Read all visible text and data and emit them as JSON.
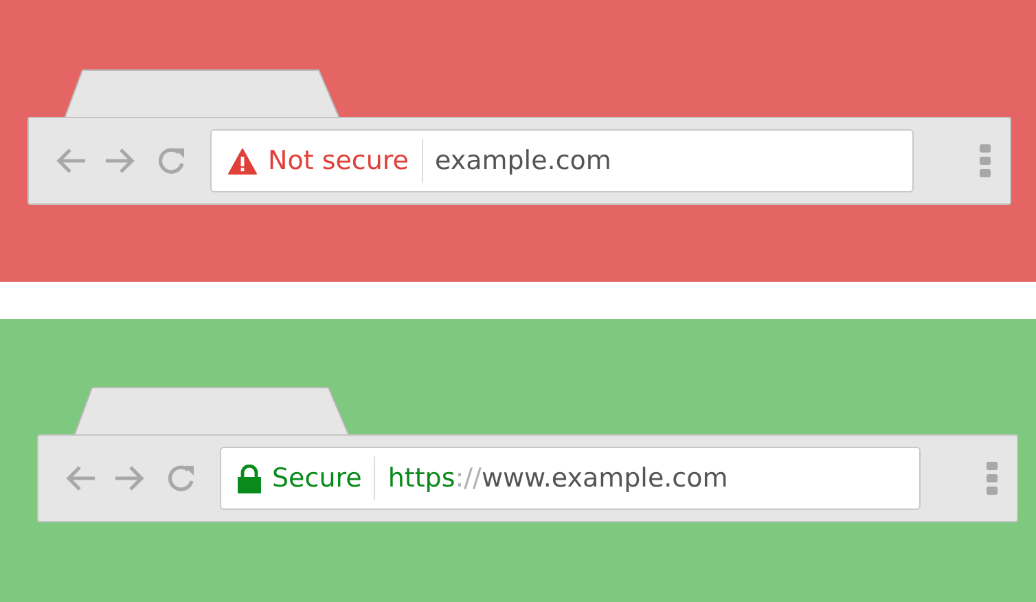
{
  "panels": [
    {
      "kind": "insecure",
      "color": "#e46564",
      "status": "Not secure",
      "url": {
        "host": "example.com"
      }
    },
    {
      "kind": "secure",
      "color": "#7fc87f",
      "status": "Secure",
      "url": {
        "scheme": "https",
        "separator": "://",
        "host": "www.example.com"
      }
    }
  ]
}
